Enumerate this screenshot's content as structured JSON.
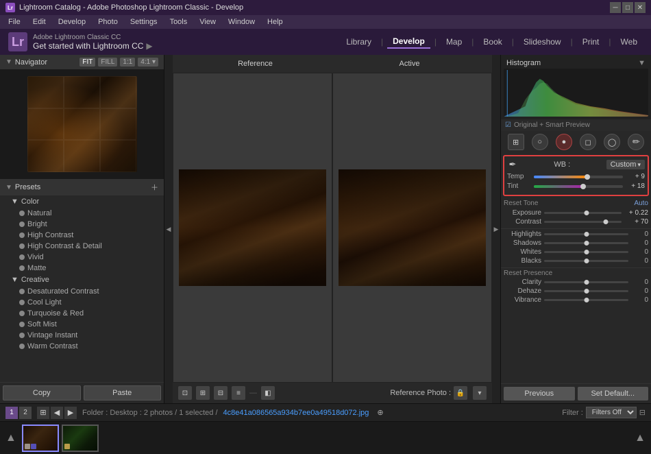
{
  "titlebar": {
    "title": "Lightroom Catalog - Adobe Photoshop Lightroom Classic - Develop",
    "icon": "Lr"
  },
  "menubar": {
    "items": [
      "File",
      "Edit",
      "Develop",
      "Photo",
      "Settings",
      "Tools",
      "View",
      "Window",
      "Help"
    ]
  },
  "appheader": {
    "badge": "Lr",
    "subtitle": "Adobe Lightroom Classic CC",
    "title": "Get started with Lightroom CC",
    "nav": [
      "Library",
      "Develop",
      "Map",
      "Book",
      "Slideshow",
      "Print",
      "Web"
    ],
    "active_nav": "Develop"
  },
  "leftpanel": {
    "navigator": {
      "title": "Navigator",
      "controls": [
        "FIT",
        "FILL",
        "1:1",
        "4:1"
      ]
    },
    "presets": {
      "title": "Presets",
      "groups": [
        {
          "name": "Color",
          "items": [
            "Natural",
            "Bright",
            "High Contrast",
            "High Contrast & Detail",
            "Vivid",
            "Matte"
          ]
        },
        {
          "name": "Creative",
          "items": [
            "Desaturated Contrast",
            "Cool Light",
            "Turquoise & Red",
            "Soft Mist",
            "Vintage Instant",
            "Warm Contrast"
          ]
        }
      ]
    },
    "buttons": {
      "copy": "Copy",
      "paste": "Paste"
    }
  },
  "center": {
    "ref_label": "Reference",
    "active_label": "Active",
    "toolbar": {
      "ref_photo": "Reference Photo :"
    }
  },
  "rightpanel": {
    "histogram_title": "Histogram",
    "preview_info": "Original + Smart Preview",
    "wb": {
      "label": "WB :",
      "value": "Custom",
      "temp_label": "Temp",
      "temp_value": "+ 9",
      "tint_label": "Tint",
      "tint_value": "+ 18"
    },
    "tone": {
      "reset_label": "Reset Tone",
      "auto_label": "Auto",
      "exposure_label": "Exposure",
      "exposure_value": "+ 0.22",
      "contrast_label": "Contrast",
      "contrast_value": "+ 70"
    },
    "adjustments": {
      "highlights_label": "Highlights",
      "highlights_value": "0",
      "shadows_label": "Shadows",
      "shadows_value": "0",
      "whites_label": "Whites",
      "whites_value": "0",
      "blacks_label": "Blacks",
      "blacks_value": "0"
    },
    "presence": {
      "reset_label": "Reset Presence",
      "clarity_label": "Clarity",
      "clarity_value": "0",
      "dehaze_label": "Dehaze",
      "dehaze_value": "0",
      "vibrance_label": "Vibrance",
      "vibrance_value": "0"
    },
    "buttons": {
      "previous": "Previous",
      "set_default": "Set Default..."
    }
  },
  "bottombar": {
    "pages": [
      "1",
      "2"
    ],
    "folder_label": "Folder : Desktop",
    "photos_info": "2 photos / 1 selected",
    "file_name": "4c8e41a086565a934b7ee0a49518d072.jpg",
    "filter_label": "Filter :",
    "filter_value": "Filters Off"
  }
}
